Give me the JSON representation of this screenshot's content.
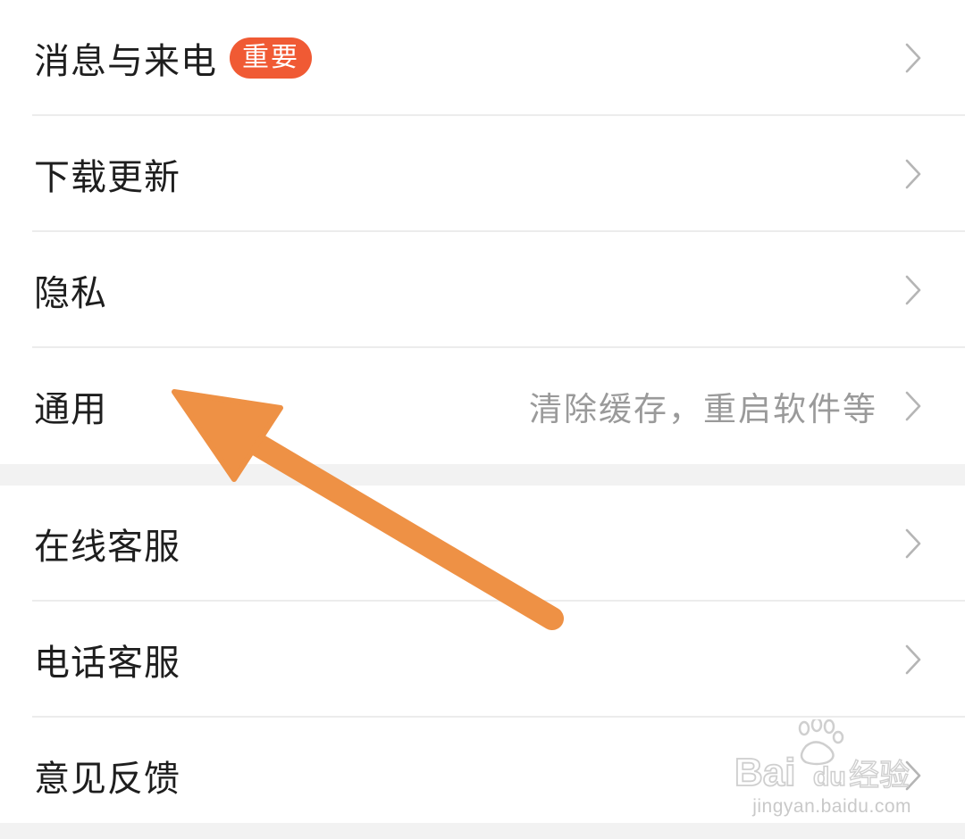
{
  "settings": {
    "group1": [
      {
        "label": "消息与来电",
        "badge": "重要",
        "hint": ""
      },
      {
        "label": "下载更新",
        "badge": "",
        "hint": ""
      },
      {
        "label": "隐私",
        "badge": "",
        "hint": ""
      },
      {
        "label": "通用",
        "badge": "",
        "hint": "清除缓存，重启软件等"
      }
    ],
    "group2": [
      {
        "label": "在线客服",
        "badge": "",
        "hint": ""
      },
      {
        "label": "电话客服",
        "badge": "",
        "hint": ""
      },
      {
        "label": "意见反馈",
        "badge": "",
        "hint": ""
      }
    ]
  },
  "icons": {
    "chevron": "chevron-right-icon",
    "annotation": "arrow-annotation"
  },
  "colors": {
    "badge": "#f05a34",
    "arrow": "#ee9145",
    "hint": "#9a9a9a",
    "chevron": "#b5b5b5"
  },
  "watermark": {
    "brand": "Bai du 经验",
    "url": "jingyan.baidu.com"
  }
}
